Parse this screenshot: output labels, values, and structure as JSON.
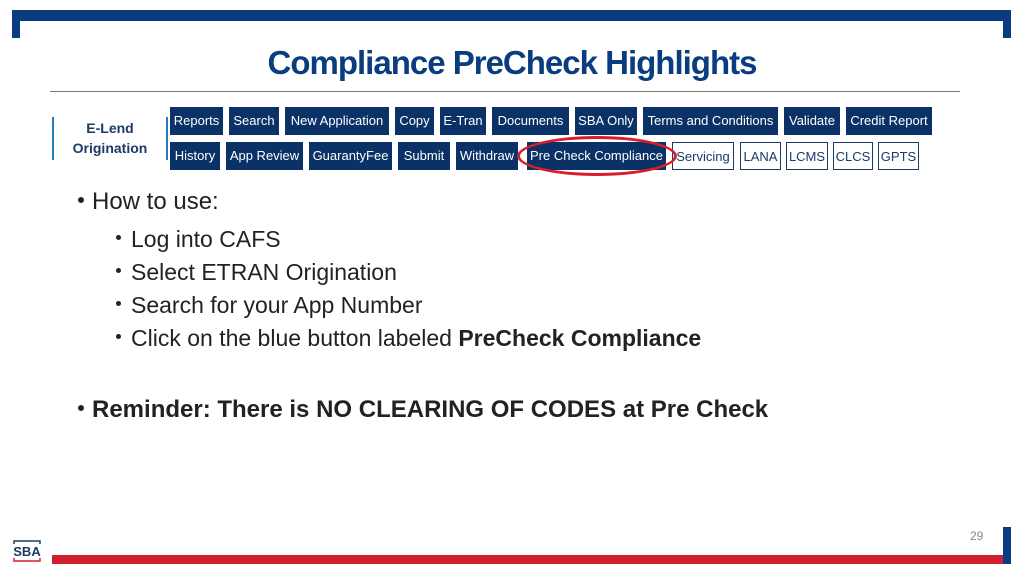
{
  "slide": {
    "title": "Compliance PreCheck Highlights",
    "page_number": "29",
    "logo_text": "SBA"
  },
  "menu": {
    "section_label_line1": "E-Lend",
    "section_label_line2": "Origination",
    "row1": [
      "Reports",
      "Search",
      "New Application",
      "Copy",
      "E-Tran",
      "Documents",
      "SBA Only",
      "Terms and Conditions",
      "Validate",
      "Credit Report"
    ],
    "row2": [
      "History",
      "App Review",
      "GuarantyFee",
      "Submit",
      "Withdraw",
      "Pre Check Compliance",
      "Servicing",
      "LANA",
      "LCMS",
      "CLCS",
      "GPTS"
    ],
    "highlighted": "Pre Check Compliance"
  },
  "content": {
    "heading": "How to use:",
    "steps": [
      "Log into CAFS",
      "Select ETRAN Origination",
      "Search for your App Number",
      "Click on the blue button labeled "
    ],
    "step4_bold": "PreCheck Compliance",
    "reminder": "Reminder:  There is NO CLEARING OF CODES at Pre Check"
  },
  "colors": {
    "brand_blue": "#0a3d7f",
    "button_blue": "#0b3266",
    "accent_red": "#d0202e"
  }
}
